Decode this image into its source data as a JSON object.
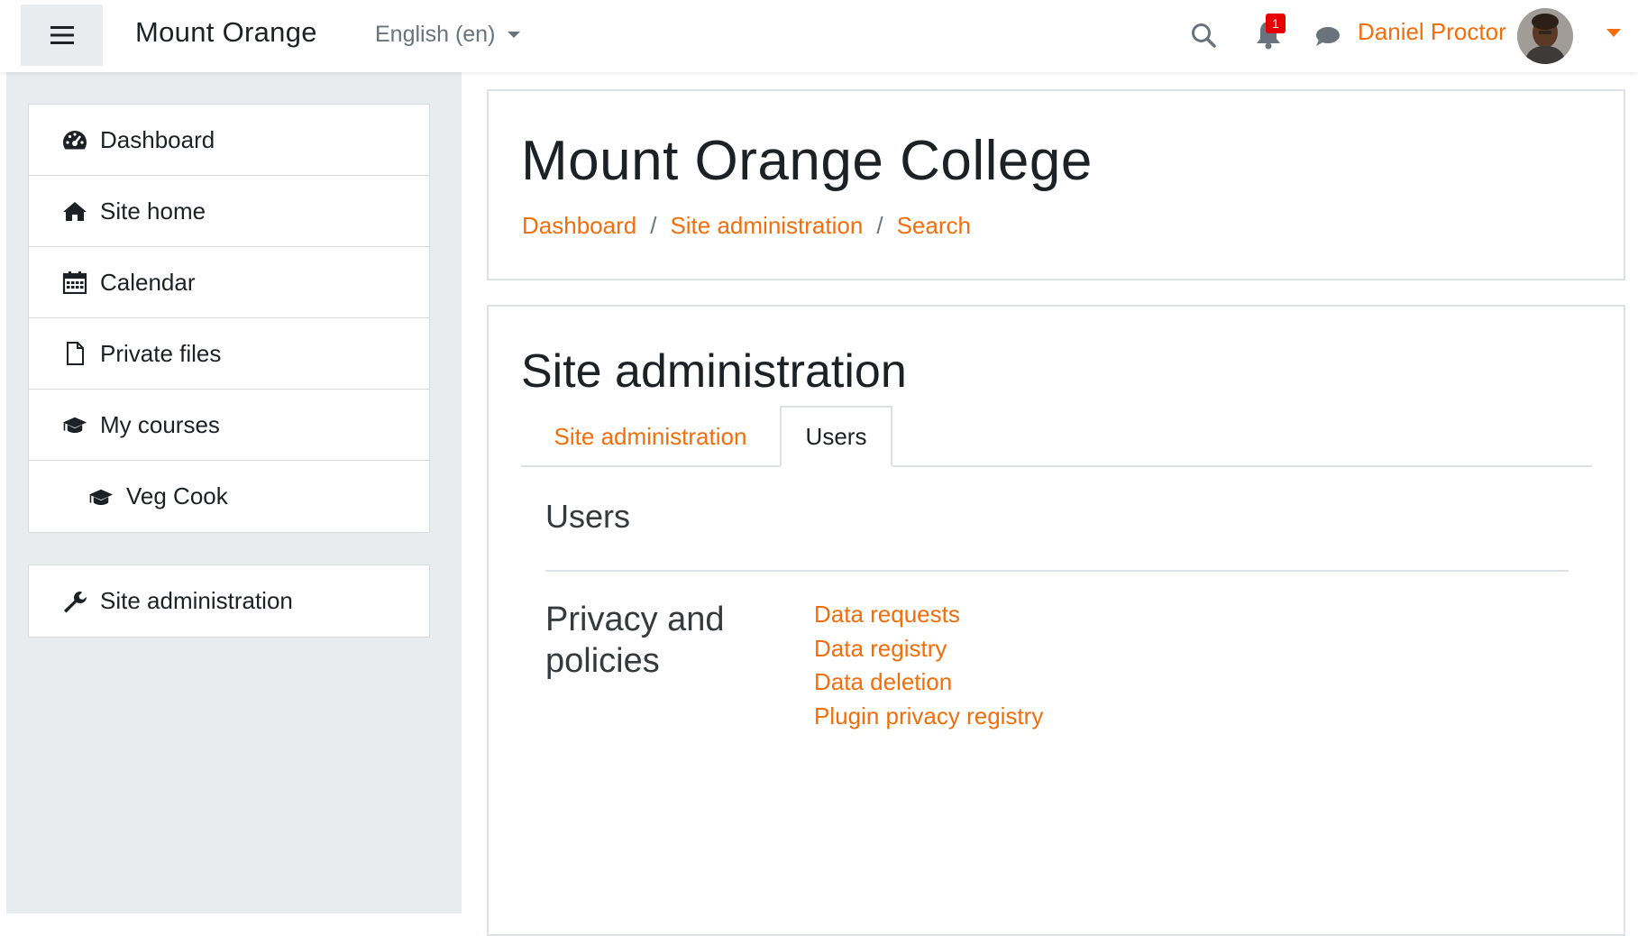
{
  "navbar": {
    "brand": "Mount Orange",
    "language": "English (en)",
    "notification_count": "1",
    "user_name": "Daniel Proctor",
    "icons": [
      "hamburger-icon",
      "search-icon",
      "bell-icon",
      "chat-icon",
      "caret-down-icon"
    ]
  },
  "sidebar": {
    "items": [
      {
        "label": "Dashboard",
        "icon": "dashboard-icon"
      },
      {
        "label": "Site home",
        "icon": "home-icon"
      },
      {
        "label": "Calendar",
        "icon": "calendar-icon"
      },
      {
        "label": "Private files",
        "icon": "file-icon"
      },
      {
        "label": "My courses",
        "icon": "graduation-cap-icon"
      },
      {
        "label": "Veg Cook",
        "icon": "graduation-cap-icon"
      }
    ],
    "admin_item": {
      "label": "Site administration",
      "icon": "wrench-icon"
    }
  },
  "header": {
    "title": "Mount Orange College",
    "breadcrumb": [
      "Dashboard",
      "Site administration",
      "Search"
    ],
    "separator": "/"
  },
  "main": {
    "heading": "Site administration",
    "tabs": [
      {
        "label": "Site administration",
        "active": false
      },
      {
        "label": "Users",
        "active": true
      }
    ],
    "section_title": "Users",
    "category": {
      "label": "Privacy and policies",
      "links": [
        "Data requests",
        "Data registry",
        "Data deletion",
        "Plugin privacy registry"
      ]
    }
  },
  "colors": {
    "accent": "#f36e0b",
    "drawer_bg": "#e9ecef",
    "badge": "#e60000",
    "text": "#1d2125"
  }
}
